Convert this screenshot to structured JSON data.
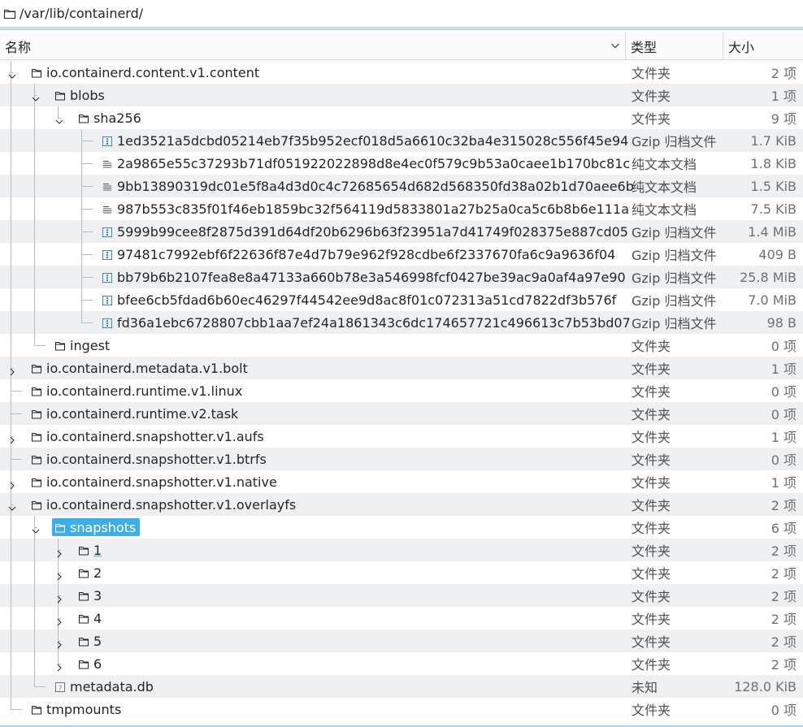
{
  "path": {
    "text": "/var/lib/containerd/"
  },
  "columns": {
    "name": "名称",
    "type": "类型",
    "size": "大小"
  },
  "rows": [
    {
      "name": "io.containerd.content.v1.content",
      "depth": 0,
      "icon": "folder-icon",
      "expander": "expanded",
      "type": "文件夹",
      "size": "2 项"
    },
    {
      "name": "blobs",
      "depth": 1,
      "icon": "folder-icon",
      "expander": "expanded",
      "type": "文件夹",
      "size": "1 项"
    },
    {
      "name": "sha256",
      "depth": 2,
      "icon": "folder-icon",
      "expander": "expanded",
      "type": "文件夹",
      "size": "9 项"
    },
    {
      "name": "1ed3521a5dcbd05214eb7f35b952ecf018d5a6610c32ba4e315028c556f45e94",
      "depth": 3,
      "icon": "archive-icon",
      "expander": "none",
      "type": "Gzip 归档文件",
      "size": "1.7 KiB"
    },
    {
      "name": "2a9865e55c37293b71df051922022898d8e4ec0f579c9b53a0caee1b170bc81c",
      "depth": 3,
      "icon": "text-file-icon",
      "expander": "none",
      "type": "纯文本文档",
      "size": "1.8 KiB"
    },
    {
      "name": "9bb13890319dc01e5f8a4d3d0c4c72685654d682d568350fd38a02b1d70aee6b",
      "depth": 3,
      "icon": "text-file-icon",
      "expander": "none",
      "type": "纯文本文档",
      "size": "1.5 KiB"
    },
    {
      "name": "987b553c835f01f46eb1859bc32f564119d5833801a27b25a0ca5c6b8b6e111a",
      "depth": 3,
      "icon": "text-file-icon",
      "expander": "none",
      "type": "纯文本文档",
      "size": "7.5 KiB"
    },
    {
      "name": "5999b99cee8f2875d391d64df20b6296b63f23951a7d41749f028375e887cd05",
      "depth": 3,
      "icon": "archive-icon",
      "expander": "none",
      "type": "Gzip 归档文件",
      "size": "1.4 MiB"
    },
    {
      "name": "97481c7992ebf6f22636f87e4d7b79e962f928cdbe6f2337670fa6c9a9636f04",
      "depth": 3,
      "icon": "archive-icon",
      "expander": "none",
      "type": "Gzip 归档文件",
      "size": "409 B"
    },
    {
      "name": "bb79b6b2107fea8e8a47133a660b78e3a546998fcf0427be39ac9a0af4a97e90",
      "depth": 3,
      "icon": "archive-icon",
      "expander": "none",
      "type": "Gzip 归档文件",
      "size": "25.8 MiB"
    },
    {
      "name": "bfee6cb5fdad6b60ec46297f44542ee9d8ac8f01c072313a51cd7822df3b576f",
      "depth": 3,
      "icon": "archive-icon",
      "expander": "none",
      "type": "Gzip 归档文件",
      "size": "7.0 MiB"
    },
    {
      "name": "fd36a1ebc6728807cbb1aa7ef24a1861343c6dc174657721c496613c7b53bd07",
      "depth": 3,
      "icon": "archive-icon",
      "expander": "none",
      "type": "Gzip 归档文件",
      "size": "98 B"
    },
    {
      "name": "ingest",
      "depth": 1,
      "icon": "folder-icon",
      "expander": "none",
      "type": "文件夹",
      "size": "0 项"
    },
    {
      "name": "io.containerd.metadata.v1.bolt",
      "depth": 0,
      "icon": "folder-icon",
      "expander": "collapsed",
      "type": "文件夹",
      "size": "1 项"
    },
    {
      "name": "io.containerd.runtime.v1.linux",
      "depth": 0,
      "icon": "folder-icon",
      "expander": "none",
      "type": "文件夹",
      "size": "0 项"
    },
    {
      "name": "io.containerd.runtime.v2.task",
      "depth": 0,
      "icon": "folder-icon",
      "expander": "none",
      "type": "文件夹",
      "size": "0 项"
    },
    {
      "name": "io.containerd.snapshotter.v1.aufs",
      "depth": 0,
      "icon": "folder-icon",
      "expander": "collapsed",
      "type": "文件夹",
      "size": "1 项"
    },
    {
      "name": "io.containerd.snapshotter.v1.btrfs",
      "depth": 0,
      "icon": "folder-icon",
      "expander": "none",
      "type": "文件夹",
      "size": "0 项"
    },
    {
      "name": "io.containerd.snapshotter.v1.native",
      "depth": 0,
      "icon": "folder-icon",
      "expander": "collapsed",
      "type": "文件夹",
      "size": "1 项"
    },
    {
      "name": "io.containerd.snapshotter.v1.overlayfs",
      "depth": 0,
      "icon": "folder-icon",
      "expander": "expanded",
      "type": "文件夹",
      "size": "2 项"
    },
    {
      "name": "snapshots",
      "depth": 1,
      "icon": "folder-icon",
      "expander": "expanded",
      "type": "文件夹",
      "size": "6 项",
      "selected": true
    },
    {
      "name": "1",
      "depth": 2,
      "icon": "folder-icon",
      "expander": "collapsed",
      "type": "文件夹",
      "size": "2 项",
      "focused": true
    },
    {
      "name": "2",
      "depth": 2,
      "icon": "folder-icon",
      "expander": "collapsed",
      "type": "文件夹",
      "size": "2 项"
    },
    {
      "name": "3",
      "depth": 2,
      "icon": "folder-icon",
      "expander": "collapsed",
      "type": "文件夹",
      "size": "2 项"
    },
    {
      "name": "4",
      "depth": 2,
      "icon": "folder-icon",
      "expander": "collapsed",
      "type": "文件夹",
      "size": "2 项"
    },
    {
      "name": "5",
      "depth": 2,
      "icon": "folder-icon",
      "expander": "collapsed",
      "type": "文件夹",
      "size": "2 项"
    },
    {
      "name": "6",
      "depth": 2,
      "icon": "folder-icon",
      "expander": "collapsed",
      "type": "文件夹",
      "size": "2 项"
    },
    {
      "name": "metadata.db",
      "depth": 1,
      "icon": "unknown-file-icon",
      "expander": "none",
      "type": "未知",
      "size": "128.0 KiB"
    },
    {
      "name": "tmpmounts",
      "depth": 0,
      "icon": "folder-icon",
      "expander": "none",
      "type": "文件夹",
      "size": "0 项"
    }
  ],
  "colors": {
    "accent": "#3daee9",
    "alternate_row": "#eff0f1",
    "text": "#232629"
  }
}
